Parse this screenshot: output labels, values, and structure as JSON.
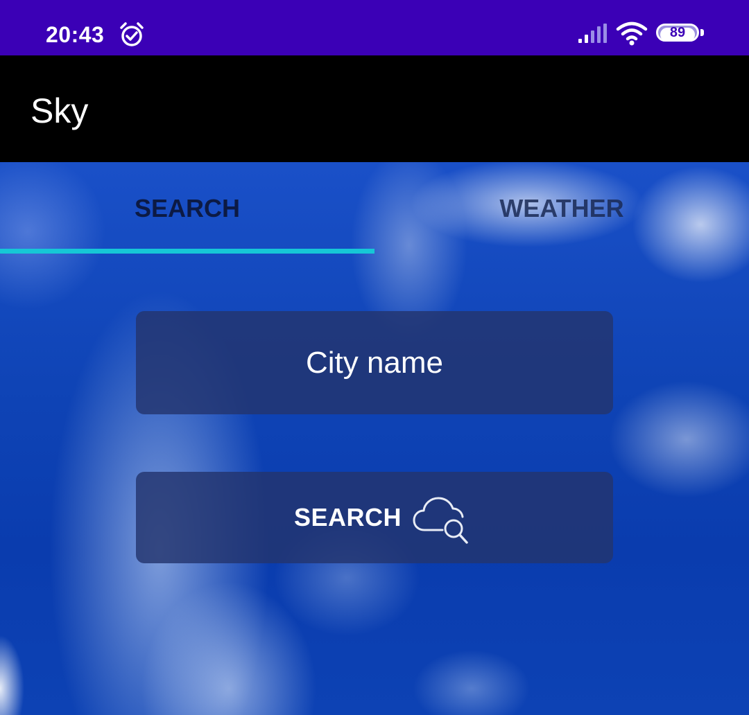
{
  "status_bar": {
    "time": "20:43",
    "battery_level": "89",
    "battery_fraction": 0.89,
    "icons": [
      "alarm-clock-icon",
      "cell-signal-icon",
      "wifi-icon",
      "battery-icon"
    ],
    "background_color": "#3b00b6"
  },
  "app_bar": {
    "title": "Sky",
    "background_color": "#000000"
  },
  "tabs": {
    "items": [
      {
        "label": "SEARCH",
        "selected": true
      },
      {
        "label": "WEATHER",
        "selected": false
      }
    ],
    "indicator_color": "#16c7d6"
  },
  "search_form": {
    "city_placeholder": "City name",
    "city_value": "",
    "search_button_label": "SEARCH",
    "search_button_icon": "cloud-search-icon"
  }
}
